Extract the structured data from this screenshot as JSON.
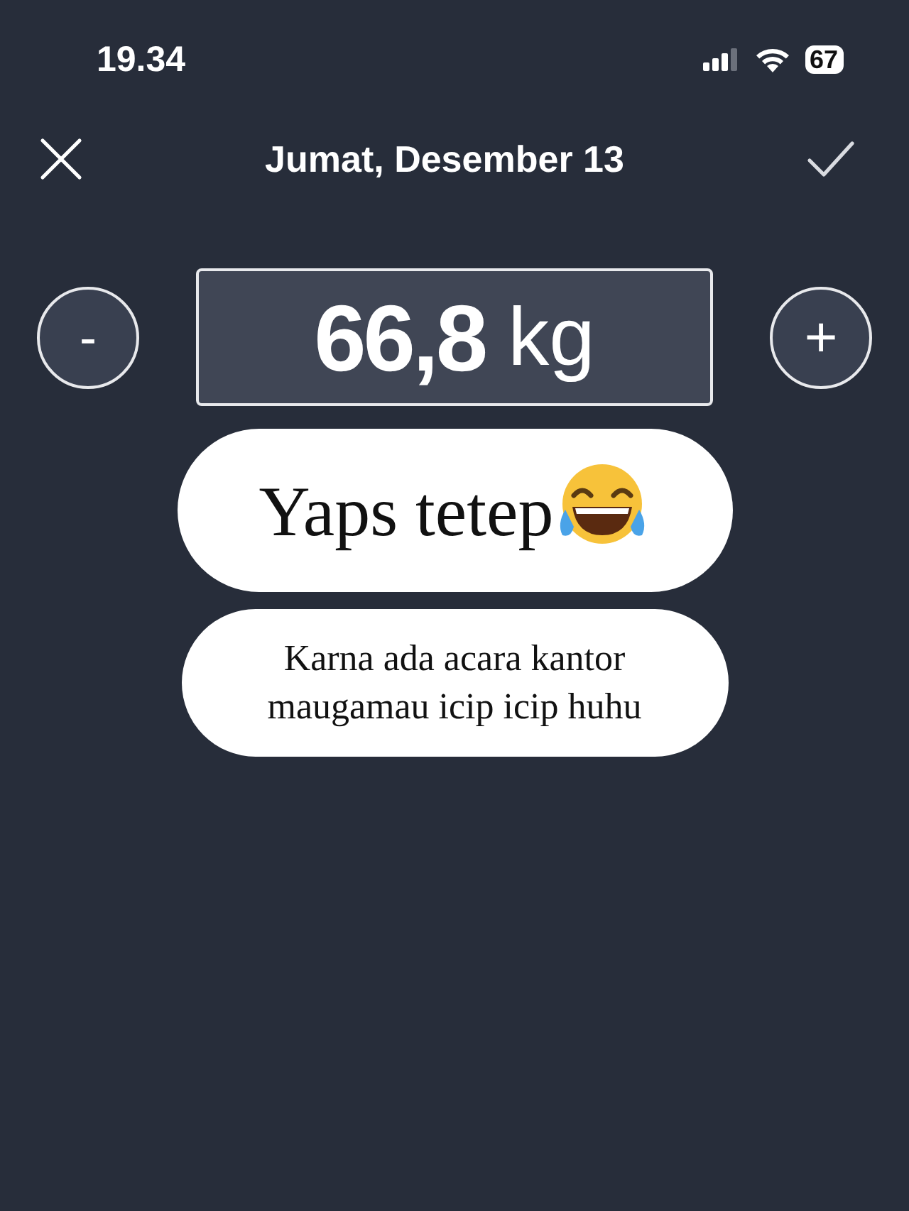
{
  "status_bar": {
    "time": "19.34",
    "battery": "67"
  },
  "header": {
    "title": "Jumat, Desember 13"
  },
  "weight": {
    "decrease": "-",
    "value": "66,8",
    "unit": "kg",
    "increase": "+"
  },
  "stickers": [
    {
      "text": "Yaps tetep",
      "emoji": true
    },
    {
      "text": "Karna ada acara kantor maugamau icip icip huhu",
      "emoji": false
    }
  ]
}
